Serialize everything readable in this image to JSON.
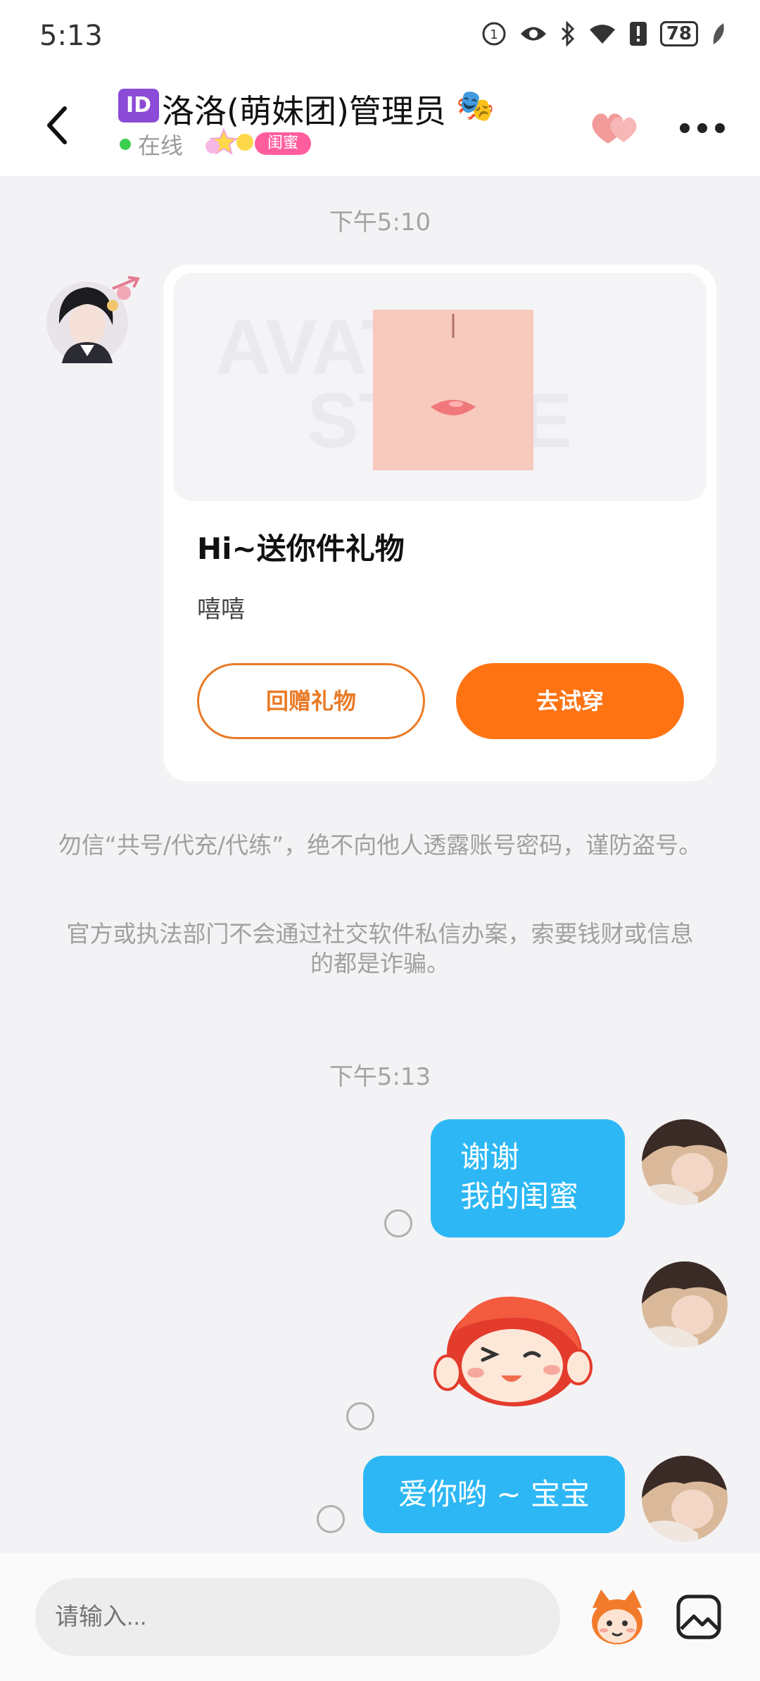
{
  "status_bar": {
    "time": "5:13",
    "battery": "78",
    "icons": [
      "sim-icon",
      "eye-icon",
      "bluetooth-icon",
      "wifi-icon",
      "alert-icon",
      "battery-icon",
      "leaf-icon"
    ]
  },
  "header": {
    "id_badge": "ID",
    "title": "洛洛(萌妹团)管理员",
    "title_emoji": "🎭",
    "status": "在线",
    "relation_badge": "闺蜜"
  },
  "chat": {
    "timestamp_1": "下午5:10",
    "gift_card": {
      "watermark_top": "AVATAR",
      "watermark_bottom": "STORE",
      "title": "Hi~送你件礼物",
      "subtitle": "嘻嘻",
      "return_button": "回赠礼物",
      "try_button": "去试穿"
    },
    "notice_1": "勿信“共号/代充/代练”，绝不向他人透露账号密码，谨防盗号。",
    "notice_2": "官方或执法部门不会通过社交软件私信办案，索要钱财或信息的都是诈骗。",
    "timestamp_2": "下午5:13",
    "messages": [
      {
        "line1": "谢谢",
        "line2": "我的闺蜜"
      },
      {
        "text": "爱你哟 ~ 宝宝"
      }
    ]
  },
  "input": {
    "placeholder": "请输入..."
  },
  "colors": {
    "accent_orange": "#ff7313",
    "bubble_blue": "#2db8f5",
    "online_green": "#3bcf4f",
    "badge_pink": "#ff5d9e"
  }
}
